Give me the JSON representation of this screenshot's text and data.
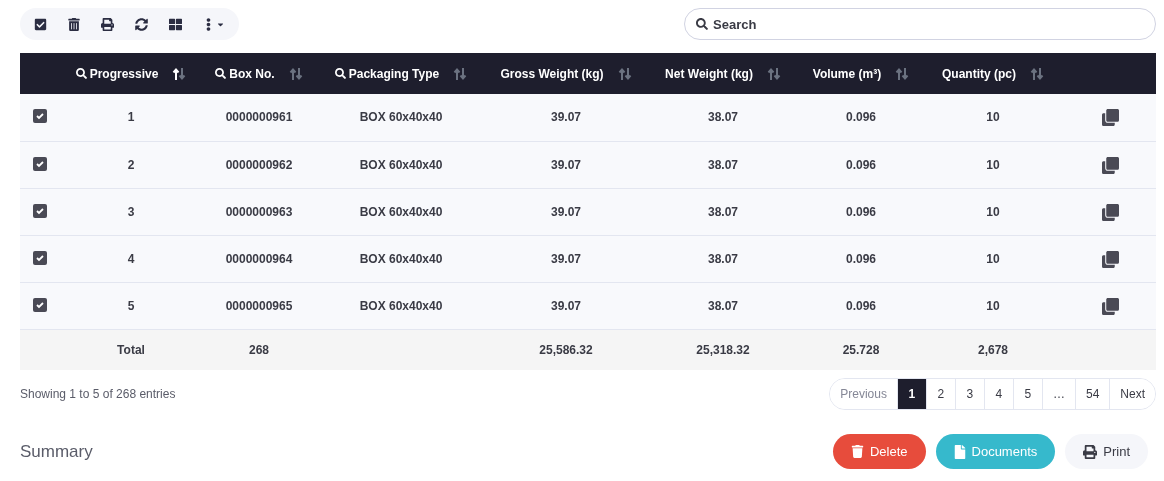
{
  "toolbar": {
    "search": {
      "placeholder": "Search"
    }
  },
  "table": {
    "columns": [
      {
        "label": "Progressive",
        "searchable": true,
        "sorted_ascending": true
      },
      {
        "label": "Box No.",
        "searchable": true,
        "sorted_ascending": false
      },
      {
        "label": "Packaging Type",
        "searchable": true,
        "sorted_ascending": false
      },
      {
        "label": "Gross Weight (kg)",
        "searchable": false,
        "sorted_ascending": false
      },
      {
        "label": "Net Weight (kg)",
        "searchable": false,
        "sorted_ascending": false
      },
      {
        "label": "Volume (m³)",
        "searchable": false,
        "sorted_ascending": false
      },
      {
        "label": "Quantity (pc)",
        "searchable": false,
        "sorted_ascending": false
      }
    ],
    "rows": [
      {
        "checked": true,
        "cells": [
          "1",
          "0000000961",
          "BOX 60x40x40",
          "39.07",
          "38.07",
          "0.096",
          "10"
        ]
      },
      {
        "checked": true,
        "cells": [
          "2",
          "0000000962",
          "BOX 60x40x40",
          "39.07",
          "38.07",
          "0.096",
          "10"
        ]
      },
      {
        "checked": true,
        "cells": [
          "3",
          "0000000963",
          "BOX 60x40x40",
          "39.07",
          "38.07",
          "0.096",
          "10"
        ]
      },
      {
        "checked": true,
        "cells": [
          "4",
          "0000000964",
          "BOX 60x40x40",
          "39.07",
          "38.07",
          "0.096",
          "10"
        ]
      },
      {
        "checked": true,
        "cells": [
          "5",
          "0000000965",
          "BOX 60x40x40",
          "39.07",
          "38.07",
          "0.096",
          "10"
        ]
      }
    ],
    "totals": {
      "label": "Total",
      "box_no": "268",
      "gross_weight": "25,586.32",
      "net_weight": "25,318.32",
      "volume": "25.728",
      "quantity": "2,678"
    }
  },
  "info": "Showing 1 to 5 of 268 entries",
  "pagination": [
    {
      "label": "Previous",
      "selected": false
    },
    {
      "label": "1",
      "selected": true
    },
    {
      "label": "2",
      "selected": false
    },
    {
      "label": "3",
      "selected": false
    },
    {
      "label": "4",
      "selected": false
    },
    {
      "label": "5",
      "selected": false
    },
    {
      "label": "…",
      "selected": false
    },
    {
      "label": "54",
      "selected": false
    },
    {
      "label": "Next",
      "selected": false
    }
  ],
  "summary_title": "Summary",
  "actions": [
    {
      "kind": "delete",
      "label": "Delete"
    },
    {
      "kind": "documents",
      "label": "Documents"
    },
    {
      "kind": "print",
      "label": "Print"
    }
  ]
}
